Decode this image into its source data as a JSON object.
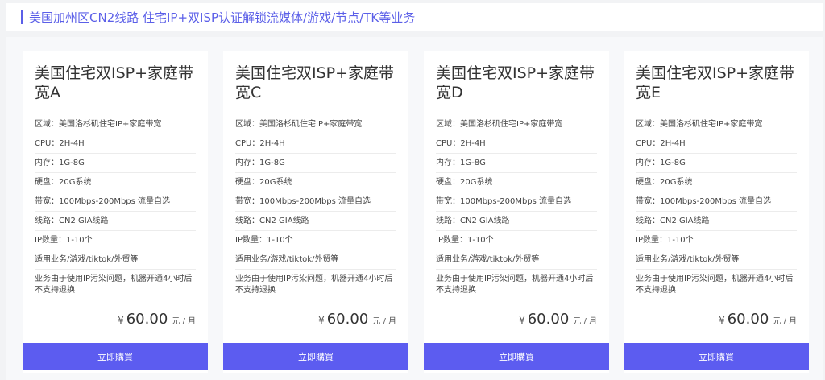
{
  "header": {
    "title": "美国加州区CN2线路 住宅IP+双ISP认证解锁流媒体/游戏/节点/TK等业务"
  },
  "products": [
    {
      "title": "美国住宅双ISP+家庭带宽A",
      "specs": [
        "区域：美国洛杉矶住宅IP+家庭带宽",
        "CPU：2H-4H",
        "内存：1G-8G",
        "硬盘：20G系统",
        "带宽：100Mbps-200Mbps 流量自选",
        "线路：CN2 GIA线路",
        "IP数量：1-10个",
        "适用业务/游戏/tiktok/外贸等",
        "业务由于使用IP污染问题，机器开通4小时后不支持退换"
      ],
      "currency": "¥",
      "price": "60.00",
      "unit": "元 / 月",
      "button": "立即購買"
    },
    {
      "title": "美国住宅双ISP+家庭带宽C",
      "specs": [
        "区域：美国洛杉矶住宅IP+家庭带宽",
        "CPU：2H-4H",
        "内存：1G-8G",
        "硬盘：20G系统",
        "带宽：100Mbps-200Mbps 流量自选",
        "线路：CN2 GIA线路",
        "IP数量：1-10个",
        "适用业务/游戏/tiktok/外贸等",
        "业务由于使用IP污染问题，机器开通4小时后不支持退换"
      ],
      "currency": "¥",
      "price": "60.00",
      "unit": "元 / 月",
      "button": "立即購買"
    },
    {
      "title": "美国住宅双ISP+家庭带宽D",
      "specs": [
        "区域：美国洛杉矶住宅IP+家庭带宽",
        "CPU：2H-4H",
        "内存：1G-8G",
        "硬盘：20G系统",
        "带宽：100Mbps-200Mbps 流量自选",
        "线路：CN2 GIA线路",
        "IP数量：1-10个",
        "适用业务/游戏/tiktok/外贸等",
        "业务由于使用IP污染问题，机器开通4小时后不支持退换"
      ],
      "currency": "¥",
      "price": "60.00",
      "unit": "元 / 月",
      "button": "立即購買"
    },
    {
      "title": "美国住宅双ISP+家庭带宽E",
      "specs": [
        "区域：美国洛杉矶住宅IP+家庭带宽",
        "CPU：2H-4H",
        "内存：1G-8G",
        "硬盘：20G系统",
        "带宽：100Mbps-200Mbps 流量自选",
        "线路：CN2 GIA线路",
        "IP数量：1-10个",
        "适用业务/游戏/tiktok/外贸等",
        "业务由于使用IP污染问题，机器开通4小时后不支持退换"
      ],
      "currency": "¥",
      "price": "60.00",
      "unit": "元 / 月",
      "button": "立即購買"
    }
  ],
  "colors": {
    "accent": "#5c5cf0",
    "header_text": "#5b5fe8"
  }
}
